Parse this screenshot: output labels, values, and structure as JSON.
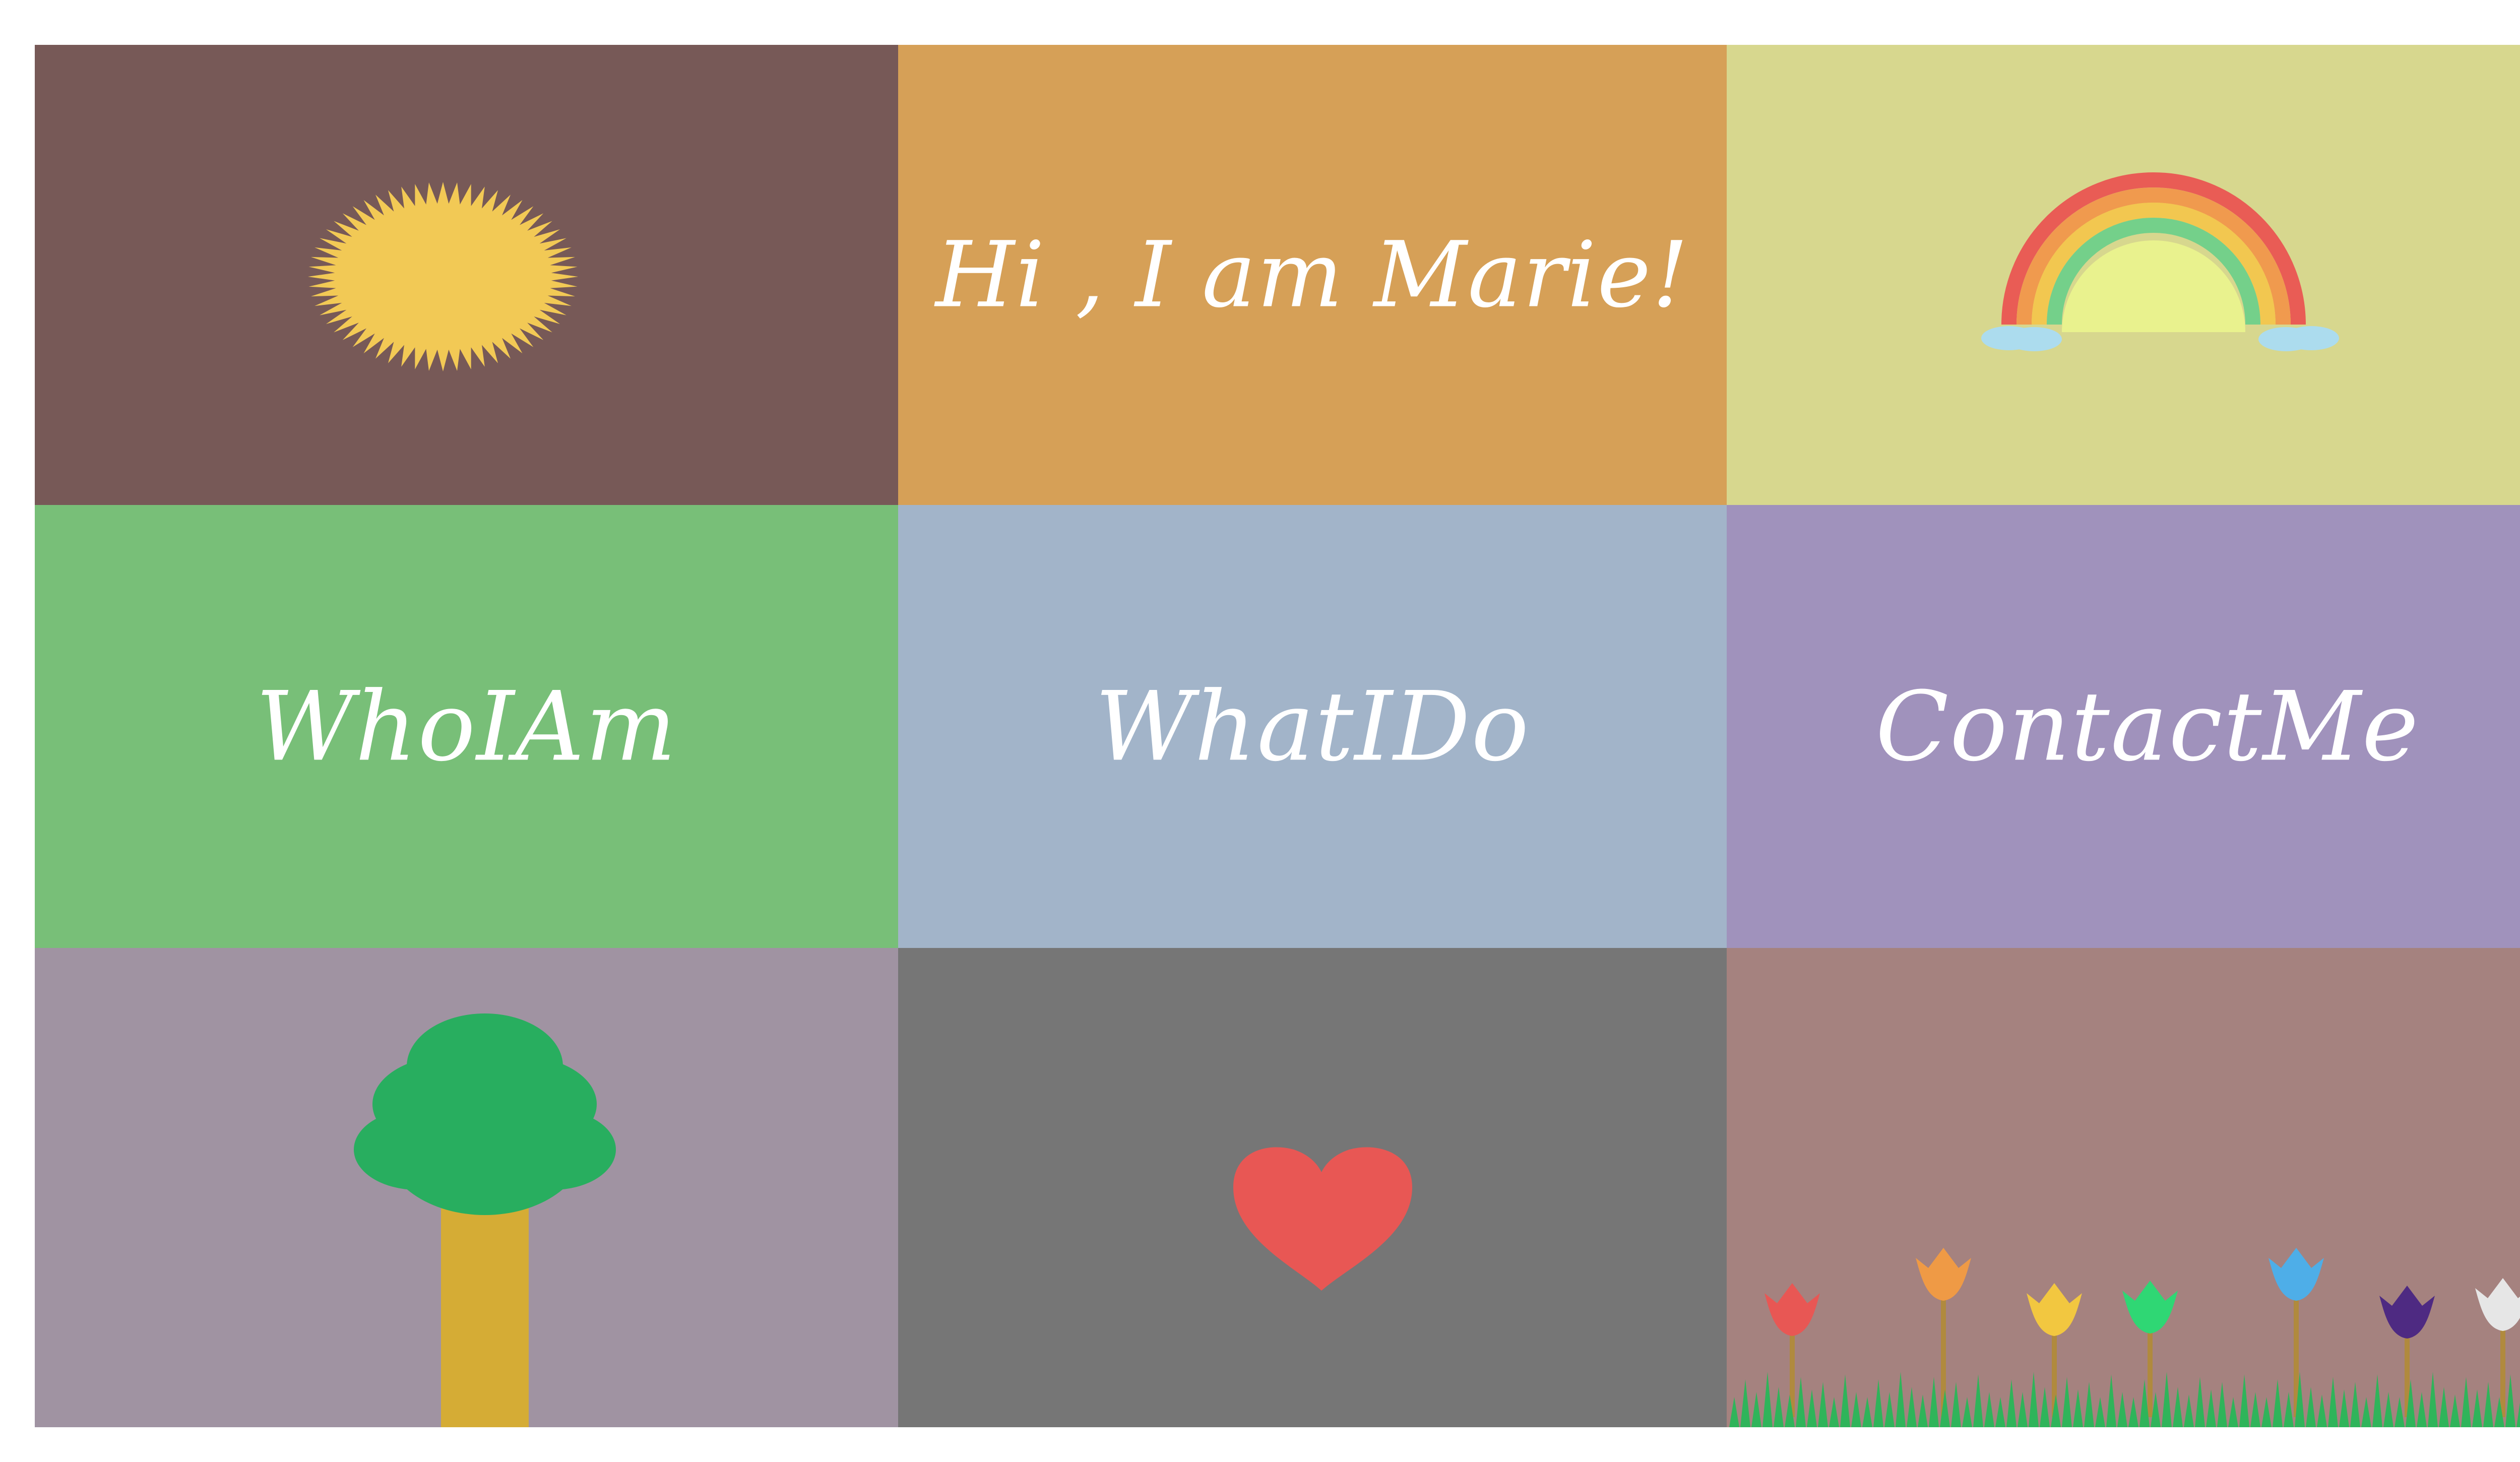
{
  "greeting": "Hi , I am Marie!",
  "nav": {
    "who": "WhoIAm",
    "what": "WhatIDo",
    "contact": "ContactMe"
  },
  "colors": {
    "sun_tile": "#775957",
    "greeting_tile": "#d6a057",
    "rainbow_tile": "#d7d78e",
    "who_tile": "#78bf78",
    "what_tile": "#a2b4c9",
    "contact_tile": "#a092bc",
    "tree_tile": "#a093a2",
    "heart_tile": "#767676",
    "flowers_tile": "#a5827f",
    "sun": "#f2c955",
    "heart": "#e85754",
    "tree_foliage": "#28ae5f",
    "tree_trunk": "#d5ac35",
    "grass": "#2fb45a"
  },
  "icons": [
    "sun-icon",
    "rainbow-icon",
    "tree-icon",
    "heart-icon",
    "tulip-icon",
    "grass-icon"
  ],
  "flowers": [
    "#e85754",
    "#ef9a45",
    "#f2c740",
    "#2fd774",
    "#4eaee8",
    "#4e2a82",
    "#e6e6e6"
  ]
}
